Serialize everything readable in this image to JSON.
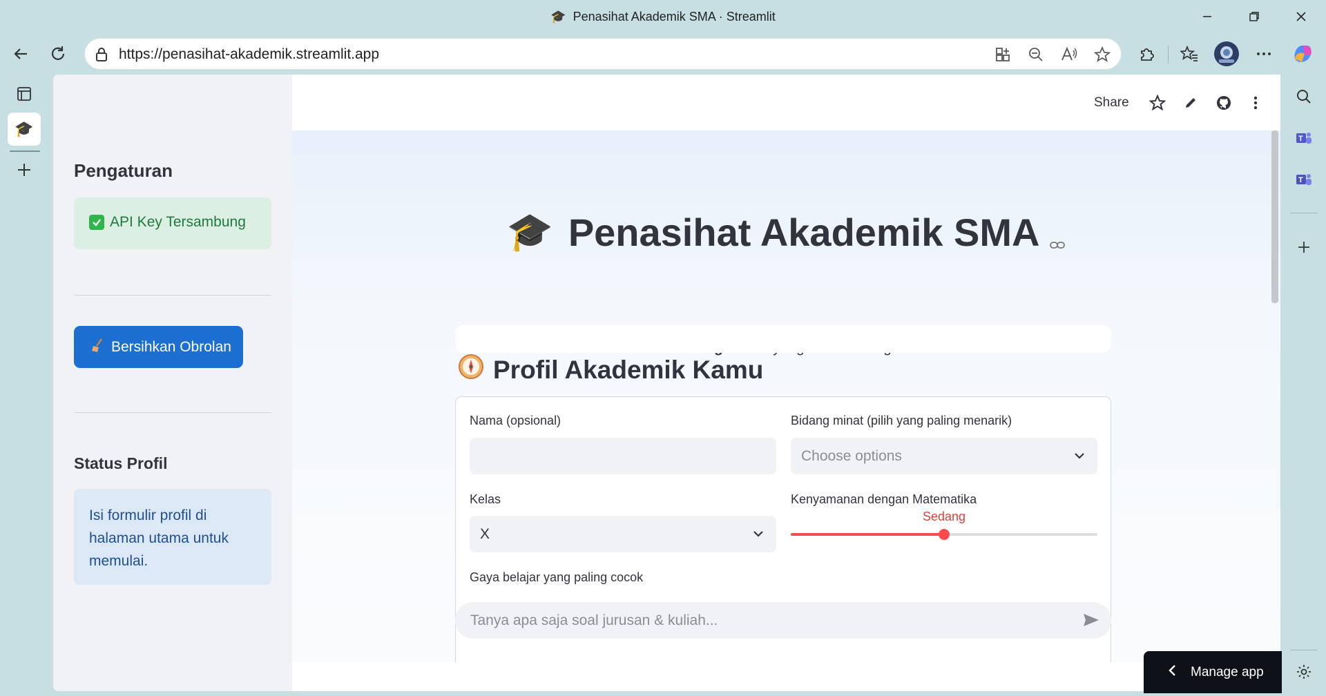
{
  "browser": {
    "window_title": "Penasihat Akademik SMA · Streamlit",
    "url": "https://penasihat-akademik.streamlit.app"
  },
  "sidebar": {
    "settings_heading": "Pengaturan",
    "api_status": "API Key Tersambung",
    "clear_button": "Bersihkan Obrolan",
    "profile_heading": "Status Profil",
    "profile_info": "Isi formulir profil di halaman utama untuk memulai."
  },
  "topbar": {
    "share": "Share"
  },
  "main": {
    "title": "Penasihat Akademik SMA",
    "subtitle_before": "Bantu kamu menemukan ",
    "subtitle_bold": "bidang kuliah",
    "subtitle_after": " yang selaras dengan kekuatan dan minatmu.",
    "profile_heading": "Profil Akademik Kamu"
  },
  "form": {
    "name_label": "Nama (opsional)",
    "name_value": "",
    "interest_label": "Bidang minat (pilih yang paling menarik)",
    "interest_placeholder": "Choose options",
    "grade_label": "Kelas",
    "grade_value": "X",
    "math_label": "Kenyamanan dengan Matematika",
    "math_value": "Sedang",
    "math_level_fraction": 0.5,
    "learning_style_label": "Gaya belajar yang paling cocok"
  },
  "chat": {
    "placeholder": "Tanya apa saja soal jurusan & kuliah..."
  },
  "manage_app": "Manage app",
  "colors": {
    "primary": "#ff4b4b",
    "button_blue": "#1c6fd1",
    "success_bg": "#dcefe3",
    "info_bg": "#dde8f7"
  }
}
